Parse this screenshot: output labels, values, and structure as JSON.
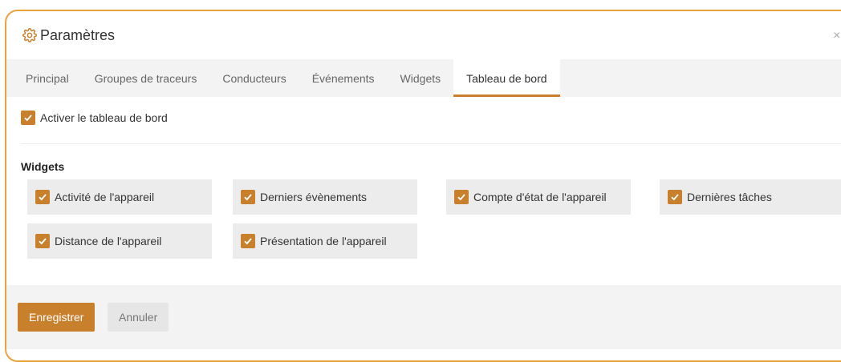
{
  "dialog": {
    "title": "Paramètres",
    "close_symbol": "×",
    "title_icon": "gear-icon"
  },
  "tabs": [
    {
      "label": "Principal",
      "active": false
    },
    {
      "label": "Groupes de traceurs",
      "active": false
    },
    {
      "label": "Conducteurs",
      "active": false
    },
    {
      "label": "Événements",
      "active": false
    },
    {
      "label": "Widgets",
      "active": false
    },
    {
      "label": "Tableau de bord",
      "active": true
    }
  ],
  "dashboard": {
    "enable_label": "Activer le tableau de bord",
    "enable_checked": true
  },
  "widgets_section": {
    "title": "Widgets",
    "items": [
      {
        "label": "Activité de l'appareil",
        "checked": true
      },
      {
        "label": "Derniers évènements",
        "checked": true
      },
      {
        "label": "Compte d'état de l'appareil",
        "checked": true
      },
      {
        "label": "Dernières tâches",
        "checked": true
      },
      {
        "label": "Distance de l'appareil",
        "checked": true
      },
      {
        "label": "Présentation de l'appareil",
        "checked": true
      }
    ]
  },
  "footer": {
    "save_label": "Enregistrer",
    "cancel_label": "Annuler"
  },
  "colors": {
    "accent": "#c8802d",
    "modal_border": "#e8a33d",
    "tab_bar_bg": "#f3f3f3",
    "widget_bg": "#ececec"
  }
}
